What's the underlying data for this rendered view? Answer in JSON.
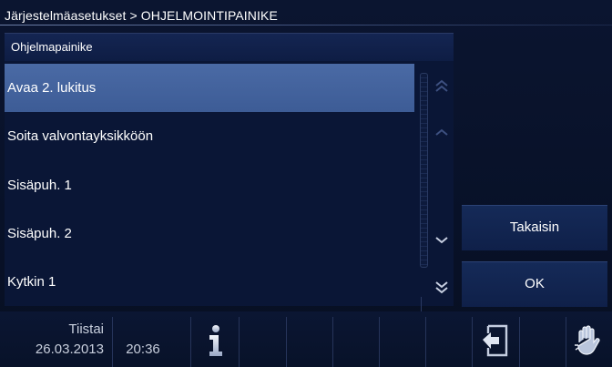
{
  "breadcrumb": "Järjestelmäasetukset > OHJELMOINTIPAINIKE",
  "panel": {
    "title": "Ohjelmapainike",
    "items": [
      {
        "label": "Avaa 2. lukitus",
        "selected": true
      },
      {
        "label": "Soita valvontayksikköön",
        "selected": false
      },
      {
        "label": "Sisäpuh. 1",
        "selected": false
      },
      {
        "label": "Sisäpuh. 2",
        "selected": false
      },
      {
        "label": "Kytkin 1",
        "selected": false
      }
    ]
  },
  "buttons": {
    "back": "Takaisin",
    "ok": "OK"
  },
  "status": {
    "day": "Tiistai",
    "date": "26.03.2013",
    "time": "20:36"
  },
  "icons": {
    "scroll_top": "double-chevron-up-icon",
    "scroll_up": "chevron-up-icon",
    "scroll_down": "chevron-down-icon",
    "scroll_bottom": "double-chevron-down-icon",
    "info": "info-icon",
    "return": "return-icon",
    "hand": "hand-icon"
  },
  "colors": {
    "background": "#081128",
    "selected_row": "#4262a0",
    "button": "#132652"
  }
}
